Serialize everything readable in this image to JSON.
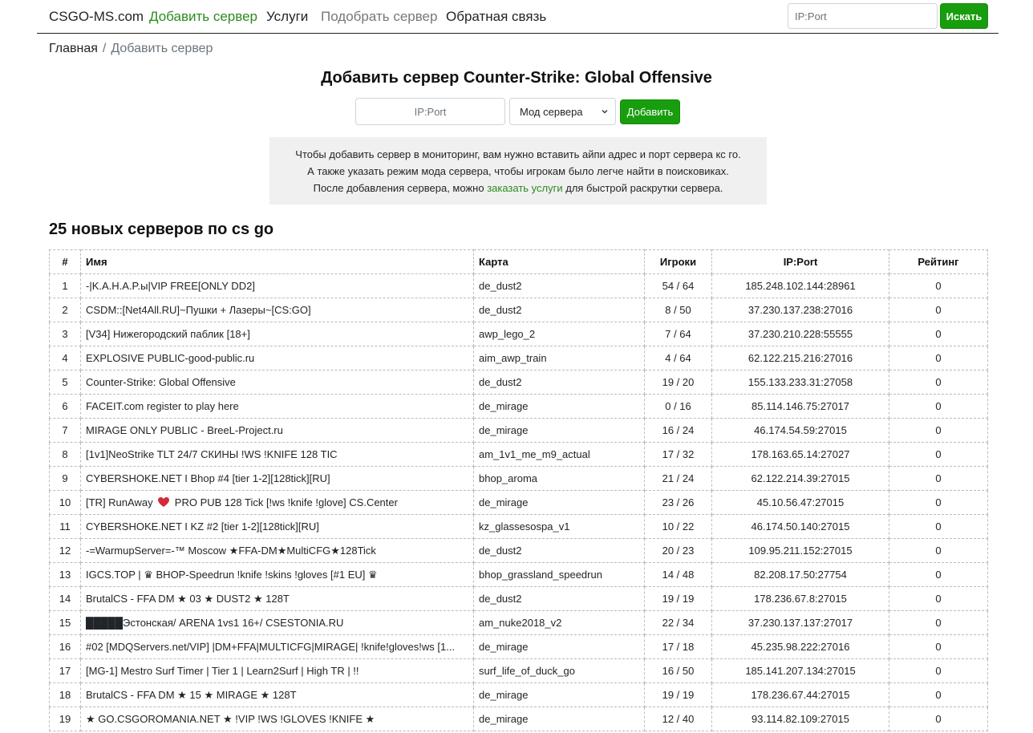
{
  "nav": {
    "brand": "CSGO-MS.com",
    "items": [
      "Добавить сервер",
      "Услуги",
      "Подобрать сервер",
      "Обратная связь"
    ],
    "search_placeholder": "IP:Port",
    "search_button": "Искать"
  },
  "breadcrumb": {
    "home": "Главная",
    "separator": "/",
    "current": "Добавить сервер"
  },
  "title": "Добавить сервер Counter-Strike: Global Offensive",
  "form": {
    "ip_placeholder": "IP:Port",
    "mode_selected": "Мод сервера",
    "add_button": "Добавить"
  },
  "info": {
    "line1": "Чтобы добавить сервер в мониторинг, вам нужно вставить айпи адрес и порт сервера кс го.",
    "line2": "А также указать режим мода сервера, чтобы игрокам было легче найти в поисковиках.",
    "line3_before": "После добавления сервера, можно ",
    "line3_link": "заказать услуги",
    "line3_after": " для быстрой раскрутки сервера."
  },
  "section_title": "25 новых серверов по cs go",
  "table": {
    "headers": [
      "#",
      "Имя",
      "Карта",
      "Игроки",
      "IP:Port",
      "Рейтинг"
    ],
    "rows": [
      {
        "n": "1",
        "name": "-|K.A.H.A.P.ы|VIP FREE[ONLY DD2]",
        "map": "de_dust2",
        "players": "54 / 64",
        "ip": "185.248.102.144:28961",
        "rating": "0"
      },
      {
        "n": "2",
        "name": "CSDM::[Net4All.RU]~Пушки + Лазеры~[CS:GO]",
        "map": "de_dust2",
        "players": "8 / 50",
        "ip": "37.230.137.238:27016",
        "rating": "0"
      },
      {
        "n": "3",
        "name": "[V34] Нижегородский паблик [18+]",
        "map": "awp_lego_2",
        "players": "7 / 64",
        "ip": "37.230.210.228:55555",
        "rating": "0"
      },
      {
        "n": "4",
        "name": "EXPLOSIVE PUBLIC-good-public.ru",
        "map": "aim_awp_train",
        "players": "4 / 64",
        "ip": "62.122.215.216:27016",
        "rating": "0"
      },
      {
        "n": "5",
        "name": "Counter-Strike: Global Offensive",
        "map": "de_dust2",
        "players": "19 / 20",
        "ip": "155.133.233.31:27058",
        "rating": "0"
      },
      {
        "n": "6",
        "name": "FACEIT.com register to play here",
        "map": "de_mirage",
        "players": "0 / 16",
        "ip": "85.114.146.75:27017",
        "rating": "0"
      },
      {
        "n": "7",
        "name": "MIRAGE ONLY PUBLIC - BreeL-Project.ru",
        "map": "de_mirage",
        "players": "16 / 24",
        "ip": "46.174.54.59:27015",
        "rating": "0"
      },
      {
        "n": "8",
        "name": "[1v1]NeoStrike TLT 24/7 СКИНЫ !WS !KNIFE 128 TIC",
        "map": "am_1v1_me_m9_actual",
        "players": "17 / 32",
        "ip": "178.163.65.14:27027",
        "rating": "0"
      },
      {
        "n": "9",
        "name": "CYBERSHOKE.NET I Bhop #4 [tier 1-2][128tick][RU]",
        "map": "bhop_aroma",
        "players": "21 / 24",
        "ip": "62.122.214.39:27015",
        "rating": "0"
      },
      {
        "n": "10",
        "name": "[TR] RunAway ❤️ PRO PUB 128 Tick [!ws !knife !glove] CS.Center",
        "map": "de_mirage",
        "players": "23 / 26",
        "ip": "45.10.56.47:27015",
        "rating": "0"
      },
      {
        "n": "11",
        "name": "CYBERSHOKE.NET I KZ #2 [tier 1-2][128tick][RU]",
        "map": "kz_glassesospa_v1",
        "players": "10 / 22",
        "ip": "46.174.50.140:27015",
        "rating": "0"
      },
      {
        "n": "12",
        "name": "-=WarmupServer=-™ Moscow ★FFA-DM★MultiCFG★128Tick",
        "map": "de_dust2",
        "players": "20 / 23",
        "ip": "109.95.211.152:27015",
        "rating": "0"
      },
      {
        "n": "13",
        "name": "IGCS.TOP | ♛ BHOP-Speedrun !knife !skins !gloves [#1 EU] ♛",
        "map": "bhop_grassland_speedrun",
        "players": "14 / 48",
        "ip": "82.208.17.50:27754",
        "rating": "0"
      },
      {
        "n": "14",
        "name": "BrutalCS - FFA DM ★ 03 ★ DUST2 ★ 128T",
        "map": "de_dust2",
        "players": "19 / 19",
        "ip": "178.236.67.8:27015",
        "rating": "0"
      },
      {
        "n": "15",
        "name": "█████Эстонская/ ARENA 1vs1 16+/ CSESTONIA.RU",
        "map": "am_nuke2018_v2",
        "players": "22 / 34",
        "ip": "37.230.137.137:27017",
        "rating": "0"
      },
      {
        "n": "16",
        "name": "#02 [MDQServers.net/VIP] |DM+FFA|MULTICFG|MIRAGE| !knife!gloves!ws [1...",
        "map": "de_mirage",
        "players": "17 / 18",
        "ip": "45.235.98.222:27016",
        "rating": "0"
      },
      {
        "n": "17",
        "name": "[MG-1] Mestro Surf Timer | Tier 1 | Learn2Surf | High TR | !!",
        "map": "surf_life_of_duck_go",
        "players": "16 / 50",
        "ip": "185.141.207.134:27015",
        "rating": "0"
      },
      {
        "n": "18",
        "name": "BrutalCS - FFA DM ★ 15 ★ MIRAGE ★ 128T",
        "map": "de_mirage",
        "players": "19 / 19",
        "ip": "178.236.67.44:27015",
        "rating": "0"
      },
      {
        "n": "19",
        "name": "★ GO.CSGOROMANIA.NET ★ !VIP !WS !GLOVES !KNIFE ★",
        "map": "de_mirage",
        "players": "12 / 40",
        "ip": "93.114.82.109:27015",
        "rating": "0"
      }
    ]
  },
  "colors": {
    "accent_green": "#189d0e",
    "link_green": "#2b8a1f",
    "info_bg": "#f0f0f0"
  }
}
